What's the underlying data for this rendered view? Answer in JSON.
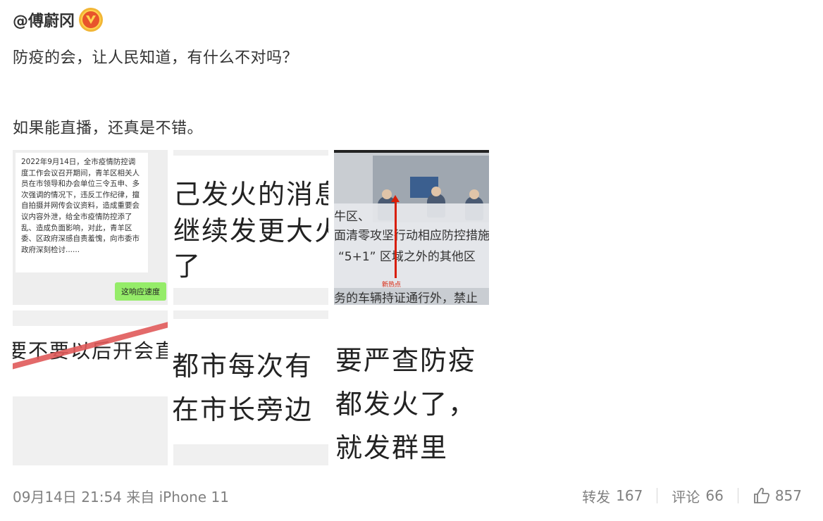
{
  "post": {
    "author": "@傅蔚冈",
    "verified_badge": "V",
    "text_line_1": "防疫的会，让人民知道，有什么不对吗？",
    "text_line_2": "如果能直播，还真是不错。"
  },
  "images": {
    "img1": {
      "message": "2022年9月14日，全市疫情防控调度工作会议召开期间，青羊区相关人员在市领导和办会单位三令五申、多次强调的情况下，违反工作纪律，擅自拍摄并网传会议资料，造成重要会议内容外泄，给全市疫情防控添了乱、造成负面影响，对此，青羊区委、区政府深感自责羞愧，向市委市政府深刻检讨......",
      "reply": "这响应速度"
    },
    "img2": {
      "line1": "己发火的消息",
      "line2": "继续发更大火",
      "line3": "了"
    },
    "img3": {
      "line1": "牛区、",
      "line2": "面清零攻坚行动相应防控措施",
      "line3": "“5+1” 区域之外的其他区",
      "label": "新热点",
      "line4": "务的车辆持证通行外，禁止"
    },
    "img4": {
      "line1": "要不要以后开会直播"
    },
    "img5": {
      "line1": "都市每次有",
      "line2": "在市长旁边"
    },
    "img6": {
      "line1": "要严查防疫",
      "line2": "都发火了，",
      "line3": "就发群里"
    }
  },
  "footer": {
    "meta": "09月14日 21:54 来自 iPhone 11",
    "repost_label": "转发",
    "repost_count": "167",
    "comment_label": "评论",
    "comment_count": "66",
    "like_count": "857",
    "like_icon": "thumbs-up-icon"
  },
  "colors": {
    "text": "#333333",
    "meta": "#808080",
    "wechat_green": "#95ec69",
    "strike_red": "#e05a5a",
    "arrow_red": "#d81e06",
    "badge_orange": "#e8542b",
    "badge_gold": "#f2b636"
  }
}
